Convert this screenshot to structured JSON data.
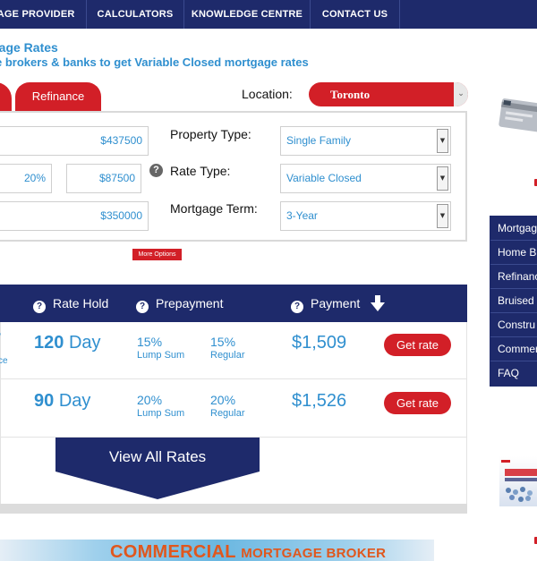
{
  "nav": {
    "items": [
      "GAGE PROVIDER",
      "CALCULATORS",
      "KNOWLEDGE CENTRE",
      "CONTACT US"
    ]
  },
  "heading": {
    "title": "rtgage Rates",
    "subtitle": "e brokers & banks to get Variable Closed mortgage rates"
  },
  "tabs": {
    "refinance": "Refinance"
  },
  "location": {
    "label": "Location:",
    "value": "Toronto"
  },
  "form": {
    "amount1": "$437500",
    "percent": "20%",
    "downpayment": "$87500",
    "amount2": "$350000",
    "property_type_label": "Property Type:",
    "property_type_value": "Single Family",
    "rate_type_label": "Rate Type:",
    "rate_type_value": "Variable Closed",
    "mortgage_term_label": "Mortgage Term:",
    "mortgage_term_value": "3-Year",
    "more_options": "More Options"
  },
  "rates": {
    "headers": {
      "rate_hold": "Rate Hold",
      "prepayment": "Prepayment",
      "payment": "Payment"
    },
    "rows": [
      {
        "cut_a": "/",
        "cut_b": "ce",
        "hold_num": "120",
        "hold_unit": "Day",
        "lump_pct": "15%",
        "lump_label": "Lump Sum",
        "reg_pct": "15%",
        "reg_label": "Regular",
        "payment": "$1,509",
        "cta": "Get rate"
      },
      {
        "cut_a": "",
        "cut_b": "",
        "hold_num": "90",
        "hold_unit": "Day",
        "lump_pct": "20%",
        "lump_label": "Lump Sum",
        "reg_pct": "20%",
        "reg_label": "Regular",
        "payment": "$1,526",
        "cta": "Get rate"
      }
    ],
    "view_all": "View All Rates"
  },
  "banner": {
    "word1": "COMMERCIAL",
    "word2": "MORTGAGE BROKER"
  },
  "sidebar": {
    "items": [
      "Mortgag",
      "Home Bu",
      "Refinanc",
      "Bruised",
      "Constru",
      "Commer",
      "FAQ"
    ]
  },
  "colors": {
    "navy": "#1e2a6b",
    "red": "#d21f27",
    "blue_text": "#2f8fcf",
    "orange": "#e0571d"
  }
}
